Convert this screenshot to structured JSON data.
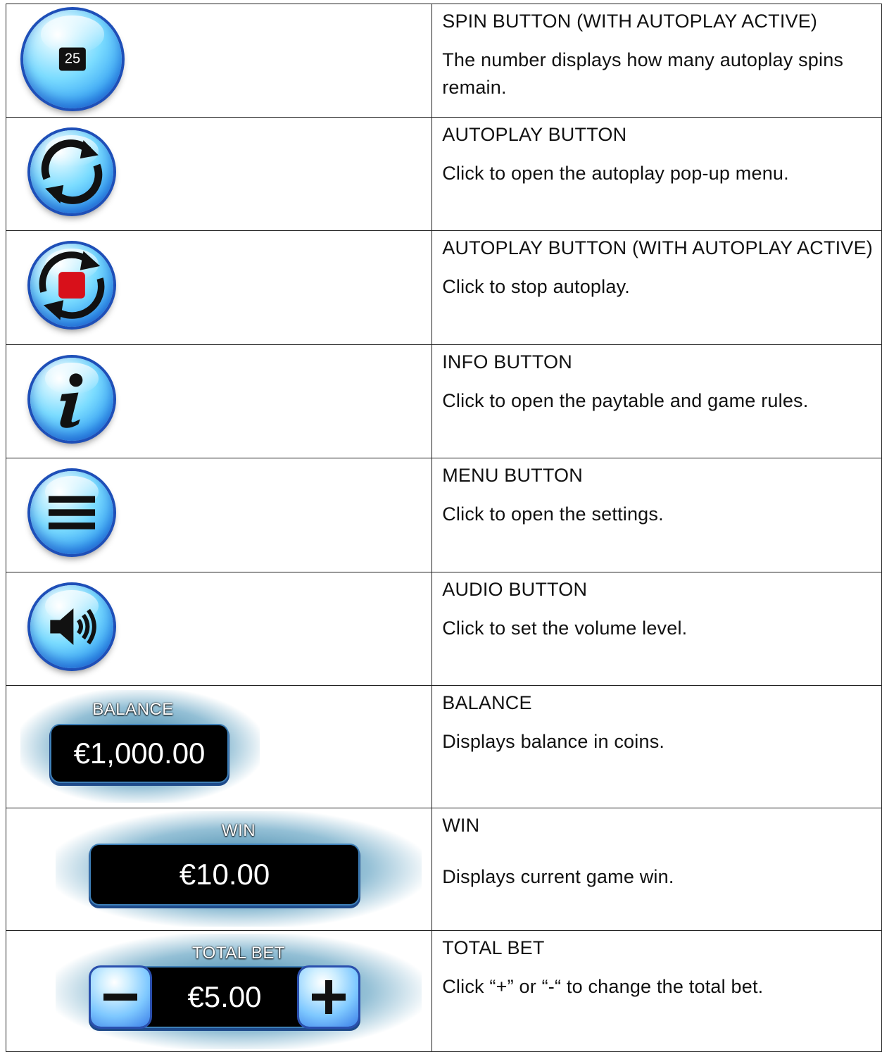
{
  "rows": [
    {
      "icon": "spin-autoplay-icon",
      "badge": "25",
      "title": "SPIN BUTTON (WITH AUTOPLAY ACTIVE)",
      "desc": "The number displays how many autoplay spins remain."
    },
    {
      "icon": "autoplay-icon",
      "title": "AUTOPLAY BUTTON",
      "desc": "Click to open the autoplay pop-up menu."
    },
    {
      "icon": "autoplay-stop-icon",
      "title": "AUTOPLAY BUTTON (WITH AUTOPLAY ACTIVE)",
      "desc": "Click to stop autoplay."
    },
    {
      "icon": "info-icon",
      "title": "INFO BUTTON",
      "desc": "Click to open the paytable and game rules."
    },
    {
      "icon": "menu-icon",
      "title": "MENU BUTTON",
      "desc": "Click to open the settings."
    },
    {
      "icon": "audio-icon",
      "title": "AUDIO BUTTON",
      "desc": "Click to set the volume level."
    },
    {
      "icon": "balance-display",
      "panel_label": "BALANCE",
      "panel_value": "€1,000.00",
      "title": "BALANCE",
      "desc": "Displays balance in coins."
    },
    {
      "icon": "win-display",
      "panel_label": "WIN",
      "panel_value": "€10.00",
      "title": "WIN",
      "desc": "Displays current game win."
    },
    {
      "icon": "total-bet-display",
      "panel_label": "TOTAL BET",
      "panel_value": "€5.00",
      "title": "TOTAL BET",
      "desc": "Click “+” or “-“ to change the total bet."
    }
  ],
  "colors": {
    "button_light": "#c9f2ff",
    "button_mid": "#3aa6f5",
    "button_rim": "#1e4fb8",
    "stop_red": "#d8101a",
    "glow": "#1e6e96"
  }
}
